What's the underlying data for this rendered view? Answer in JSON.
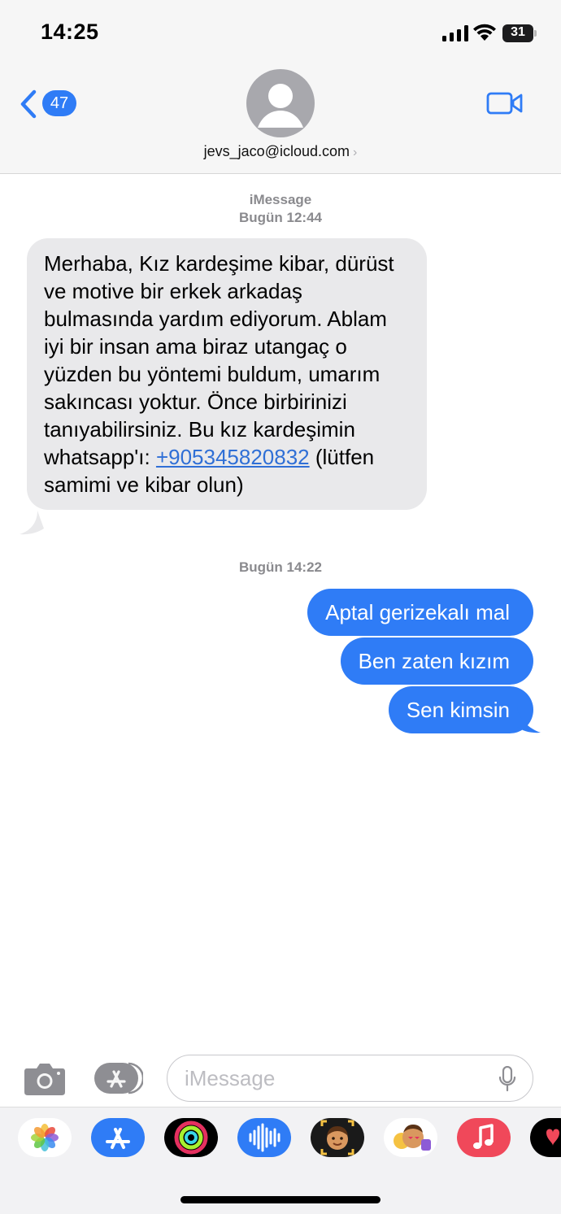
{
  "status_bar": {
    "time": "14:25",
    "battery": "31",
    "icons": [
      "signal-icon",
      "wifi-icon",
      "battery-icon"
    ]
  },
  "header": {
    "back_icon": "chevron-left-icon",
    "back_badge": "47",
    "avatar_icon": "person-icon",
    "contact": "jevs_jaco@icloud.com",
    "contact_chevron": "›",
    "video_icon": "video-camera-icon"
  },
  "thread": {
    "service_label": "iMessage",
    "first_timestamp": "Bugün 12:44",
    "incoming": {
      "text_before_link": "Merhaba, Kız kardeşime kibar, dürüst ve motive bir erkek arkadaş bulmasında yardım ediyorum. Ablam iyi bir insan ama biraz utangaç o yüzden bu yöntemi buldum, umarım sakıncası yoktur. Önce birbirinizi tanıyabilirsiniz. Bu kız kardeşimin whatsapp'ı: ",
      "link": "+905345820832",
      "text_after_link": " (lütfen samimi ve kibar olun)"
    },
    "second_timestamp": "Bugün 14:22",
    "outgoing": [
      {
        "text": "Aptal gerizekalı mal"
      },
      {
        "text": "Ben zaten kızım"
      },
      {
        "text": "Sen kimsin"
      }
    ]
  },
  "composer": {
    "camera_icon": "camera-icon",
    "apps_icon": "app-store-icon",
    "placeholder": "iMessage",
    "mic_icon": "microphone-icon"
  },
  "app_drawer": {
    "apps": [
      "photos-icon",
      "app-store-icon",
      "activity-icon",
      "audio-message-icon",
      "memoji-icon",
      "animoji-stickers-icon",
      "music-icon",
      "digital-touch-icon"
    ]
  },
  "colors": {
    "accent": "#2f7cf6",
    "incoming_bubble": "#e9e9eb",
    "link": "#2f6fd6"
  }
}
